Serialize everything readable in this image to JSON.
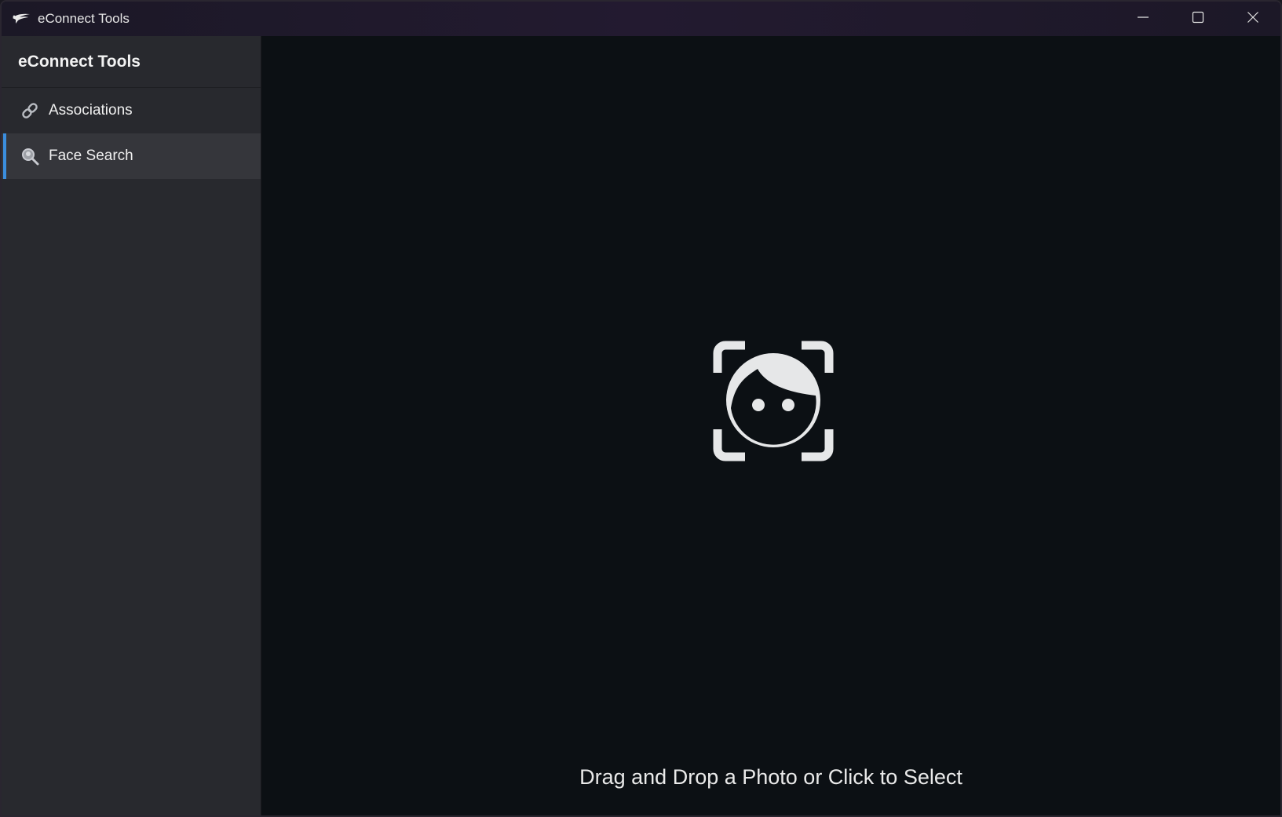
{
  "window": {
    "title": "eConnect Tools",
    "icons": {
      "app": "bird-logo-icon",
      "minimize": "minimize-icon",
      "maximize": "maximize-icon",
      "close": "close-icon"
    }
  },
  "sidebar": {
    "header": "eConnect Tools",
    "items": [
      {
        "label": "Associations",
        "icon": "link-icon",
        "active": false
      },
      {
        "label": "Face Search",
        "icon": "face-search-icon",
        "active": true
      }
    ]
  },
  "main": {
    "icon": "face-scan-icon",
    "prompt": "Drag and Drop a Photo or Click to Select"
  },
  "colors": {
    "accent": "#3b8ede",
    "sidebar_bg": "#28292e",
    "main_bg": "#0c1014",
    "text": "#eaeaea"
  }
}
